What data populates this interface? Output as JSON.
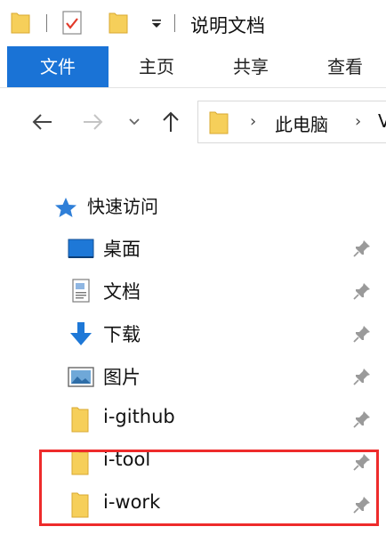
{
  "window": {
    "title": "说明文档"
  },
  "ribbon": {
    "tabs": [
      {
        "label": "文件",
        "active": true
      },
      {
        "label": "主页",
        "active": false
      },
      {
        "label": "共享",
        "active": false
      },
      {
        "label": "查看",
        "active": false
      }
    ]
  },
  "address_bar": {
    "crumbs": [
      "此电脑"
    ],
    "overflow_text": "V"
  },
  "nav_pane": {
    "quick_access_label": "快速访问",
    "items": [
      {
        "label": "桌面",
        "icon": "desktop-icon"
      },
      {
        "label": "文档",
        "icon": "documents-icon"
      },
      {
        "label": "下载",
        "icon": "download-icon"
      },
      {
        "label": "图片",
        "icon": "pictures-icon"
      },
      {
        "label": "i-github",
        "icon": "folder-icon"
      },
      {
        "label": "i-tool",
        "icon": "folder-icon"
      },
      {
        "label": "i-work",
        "icon": "folder-icon"
      }
    ]
  },
  "colors": {
    "accent": "#1a73d6",
    "folder": "#f6cf5a",
    "highlight": "#ee2b2b"
  }
}
